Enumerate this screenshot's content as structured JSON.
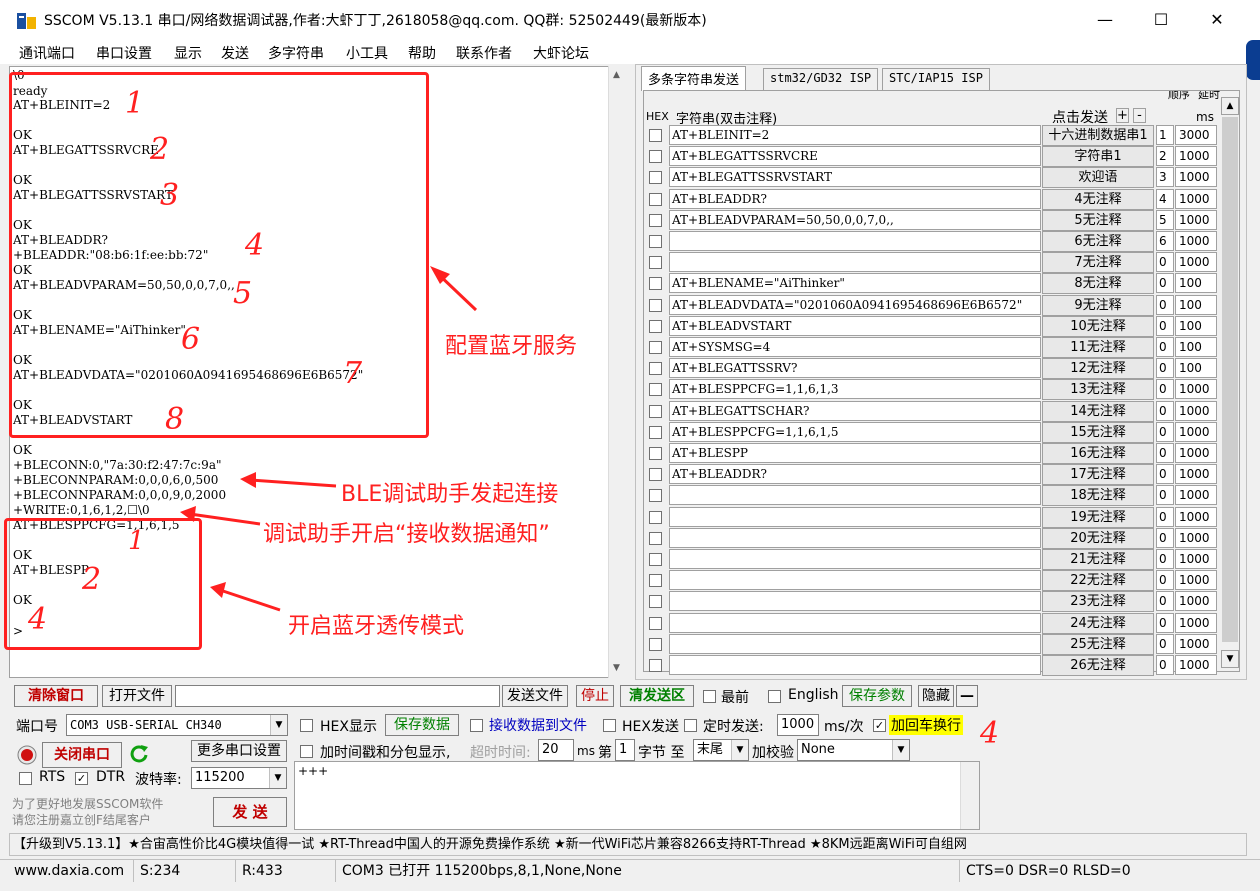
{
  "window": {
    "title": "SSCOM V5.13.1 串口/网络数据调试器,作者:大虾丁丁,2618058@qq.com. QQ群: 52502449(最新版本)",
    "minimize": "—",
    "maximize": "☐",
    "close": "✕"
  },
  "menu": [
    "通讯端口",
    "串口设置",
    "显示",
    "发送",
    "多字符串",
    "小工具",
    "帮助",
    "联系作者",
    "大虾论坛"
  ],
  "receive": {
    "lines": [
      "\\0",
      "ready",
      "AT+BLEINIT=2",
      "",
      "OK",
      "AT+BLEGATTSSRVCRE",
      "",
      "OK",
      "AT+BLEGATTSSRVSTART",
      "",
      "OK",
      "AT+BLEADDR?",
      "+BLEADDR:\"08:b6:1f:ee:bb:72\"",
      "OK",
      "AT+BLEADVPARAM=50,50,0,0,7,0,,",
      "",
      "OK",
      "AT+BLENAME=\"AiThinker\"",
      "",
      "OK",
      "AT+BLEADVDATA=\"0201060A0941695468696E6B6572\"",
      "",
      "OK",
      "AT+BLEADVSTART",
      "",
      "",
      "OK",
      "+BLECONN:0,\"7a:30:f2:47:7c:9a\"",
      "+BLECONNPARAM:0,0,0,6,0,500",
      "+BLECONNPARAM:0,0,0,9,0,2000",
      "+WRITE:0,1,6,1,2,☐\\0",
      "AT+BLESPPCFG=1,1,6,1,5",
      "",
      "OK",
      "AT+BLESPP",
      "",
      "OK",
      "",
      ">"
    ]
  },
  "tabs": [
    "多条字符串发送",
    "stm32/GD32 ISP",
    "STC/IAP15 ISP"
  ],
  "multi": {
    "hdr_hex": "HEX",
    "hdr_string": "字符串(双击注释)",
    "hdr_click": "点击发送",
    "hdr_plus": "+",
    "hdr_minus": "-",
    "hdr_order": "顺序",
    "hdr_delay": "延时",
    "hdr_ms": "ms",
    "rows": [
      {
        "cmd": "AT+BLEINIT=2",
        "btn": "十六进制数据串1",
        "ord": "1",
        "dly": "3000"
      },
      {
        "cmd": "AT+BLEGATTSSRVCRE",
        "btn": "字符串1",
        "ord": "2",
        "dly": "1000"
      },
      {
        "cmd": "AT+BLEGATTSSRVSTART",
        "btn": "欢迎语",
        "ord": "3",
        "dly": "1000"
      },
      {
        "cmd": "AT+BLEADDR?",
        "btn": "4无注释",
        "ord": "4",
        "dly": "1000"
      },
      {
        "cmd": "AT+BLEADVPARAM=50,50,0,0,7,0,,",
        "btn": "5无注释",
        "ord": "5",
        "dly": "1000"
      },
      {
        "cmd": "",
        "btn": "6无注释",
        "ord": "6",
        "dly": "1000"
      },
      {
        "cmd": "",
        "btn": "7无注释",
        "ord": "0",
        "dly": "1000"
      },
      {
        "cmd": "AT+BLENAME=\"AiThinker\"",
        "btn": "8无注释",
        "ord": "0",
        "dly": "100"
      },
      {
        "cmd": "AT+BLEADVDATA=\"0201060A0941695468696E6B6572\"",
        "btn": "9无注释",
        "ord": "0",
        "dly": "100"
      },
      {
        "cmd": "AT+BLEADVSTART",
        "btn": "10无注释",
        "ord": "0",
        "dly": "100"
      },
      {
        "cmd": "AT+SYSMSG=4",
        "btn": "11无注释",
        "ord": "0",
        "dly": "100"
      },
      {
        "cmd": "AT+BLEGATTSSRV?",
        "btn": "12无注释",
        "ord": "0",
        "dly": "100"
      },
      {
        "cmd": "AT+BLESPPCFG=1,1,6,1,3",
        "btn": "13无注释",
        "ord": "0",
        "dly": "1000"
      },
      {
        "cmd": "AT+BLEGATTSCHAR?",
        "btn": "14无注释",
        "ord": "0",
        "dly": "1000"
      },
      {
        "cmd": "AT+BLESPPCFG=1,1,6,1,5",
        "btn": "15无注释",
        "ord": "0",
        "dly": "1000"
      },
      {
        "cmd": "AT+BLESPP",
        "btn": "16无注释",
        "ord": "0",
        "dly": "1000"
      },
      {
        "cmd": "AT+BLEADDR?",
        "btn": "17无注释",
        "ord": "0",
        "dly": "1000"
      },
      {
        "cmd": "",
        "btn": "18无注释",
        "ord": "0",
        "dly": "1000"
      },
      {
        "cmd": "",
        "btn": "19无注释",
        "ord": "0",
        "dly": "1000"
      },
      {
        "cmd": "",
        "btn": "20无注释",
        "ord": "0",
        "dly": "1000"
      },
      {
        "cmd": "",
        "btn": "21无注释",
        "ord": "0",
        "dly": "1000"
      },
      {
        "cmd": "",
        "btn": "22无注释",
        "ord": "0",
        "dly": "1000"
      },
      {
        "cmd": "",
        "btn": "23无注释",
        "ord": "0",
        "dly": "1000"
      },
      {
        "cmd": "",
        "btn": "24无注释",
        "ord": "0",
        "dly": "1000"
      },
      {
        "cmd": "",
        "btn": "25无注释",
        "ord": "0",
        "dly": "1000"
      },
      {
        "cmd": "",
        "btn": "26无注释",
        "ord": "0",
        "dly": "1000"
      }
    ]
  },
  "toolbar": {
    "clear": "清除窗口",
    "open_file": "打开文件",
    "send_file": "发送文件",
    "stop": "停止",
    "clear_send": "清发送区",
    "topmost": "最前",
    "english": "English",
    "save_params": "保存参数",
    "hide": "隐藏",
    "collapse": "—"
  },
  "port": {
    "label": "端口号",
    "value": "COM3 USB-SERIAL CH340",
    "close_btn": "关闭串口",
    "more_settings": "更多串口设置",
    "rts": "RTS",
    "dtr": "DTR",
    "baud_label": "波特率:",
    "baud": "115200",
    "promo": "为了更好地发展SSCOM软件",
    "promo2": "请您注册嘉立创F结尾客户",
    "send": "发  送"
  },
  "options": {
    "hex_display": "HEX显示",
    "save_data": "保存数据",
    "recv_to_file": "接收数据到文件",
    "hex_send": "HEX发送",
    "timed_send": "定时发送:",
    "interval": "1000",
    "interval_unit": "ms/次",
    "add_crlf": "加回车换行",
    "timestamp": "加时间戳和分包显示,",
    "timeout_label": "超时时间:",
    "timeout": "20",
    "ms": "ms",
    "byte_label_1": "第",
    "byte_from": "1",
    "byte_label_2": "字节 至",
    "byte_to": "末尾",
    "checksum_label": "加校验",
    "checksum": "None"
  },
  "send_text": "+++",
  "ticker": "【升级到V5.13.1】★合宙高性价比4G模块值得一试 ★RT-Thread中国人的开源免费操作系统 ★新一代WiFi芯片兼容8266支持RT-Thread ★8KM远距离WiFi可自组网",
  "status": {
    "site": "www.daxia.com",
    "sent": "S:234",
    "recv": "R:433",
    "port_info": "COM3 已打开  115200bps,8,1,None,None",
    "lines": "CTS=0 DSR=0 RLSD=0"
  },
  "annotations": {
    "config": "配置蓝牙服务",
    "ble_connect": "BLE调试助手发起连接",
    "notify": "调试助手开启“接收数据通知”",
    "spp": "开启蓝牙透传模式",
    "n1": "1",
    "n2": "2",
    "n3": "3",
    "n4": "4",
    "n5": "5",
    "n6": "6",
    "n7": "7",
    "n8": "8",
    "m1": "1",
    "m2": "2",
    "m3": "4",
    "m4": "4"
  }
}
